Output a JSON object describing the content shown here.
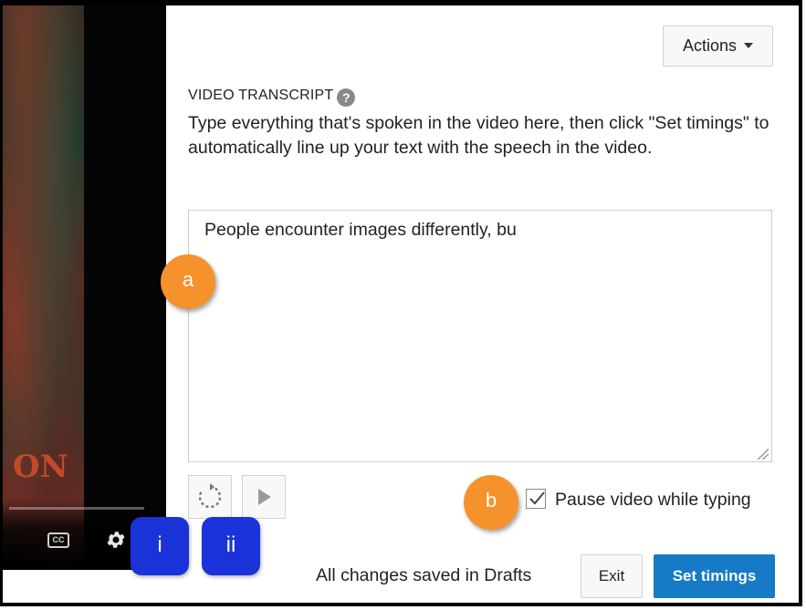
{
  "player": {
    "overlay_text": "ON",
    "cc_label": "CC",
    "icons": [
      "cc-icon",
      "gear-icon"
    ]
  },
  "toolbar": {
    "actions_label": "Actions"
  },
  "transcript": {
    "section_title": "VIDEO TRANSCRIPT",
    "help_symbol": "?",
    "instructions": "Type everything that's spoken in the video here, then click \"Set timings\" to automatically line up your text with the speech in the video.",
    "value": "People encounter images differently, bu"
  },
  "controls": {
    "icons": [
      "refresh-icon",
      "play-icon"
    ],
    "pause_checkbox_checked": true,
    "pause_label": "Pause video while typing"
  },
  "footer": {
    "status_text": "All changes saved in Drafts",
    "exit_label": "Exit",
    "set_timings_label": "Set timings"
  },
  "annotations": {
    "a": "a",
    "b": "b",
    "i": "i",
    "ii": "ii"
  },
  "colors": {
    "primary_button": "#167ac6",
    "marker_orange": "#f5922c",
    "marker_blue": "#1a33d8"
  }
}
